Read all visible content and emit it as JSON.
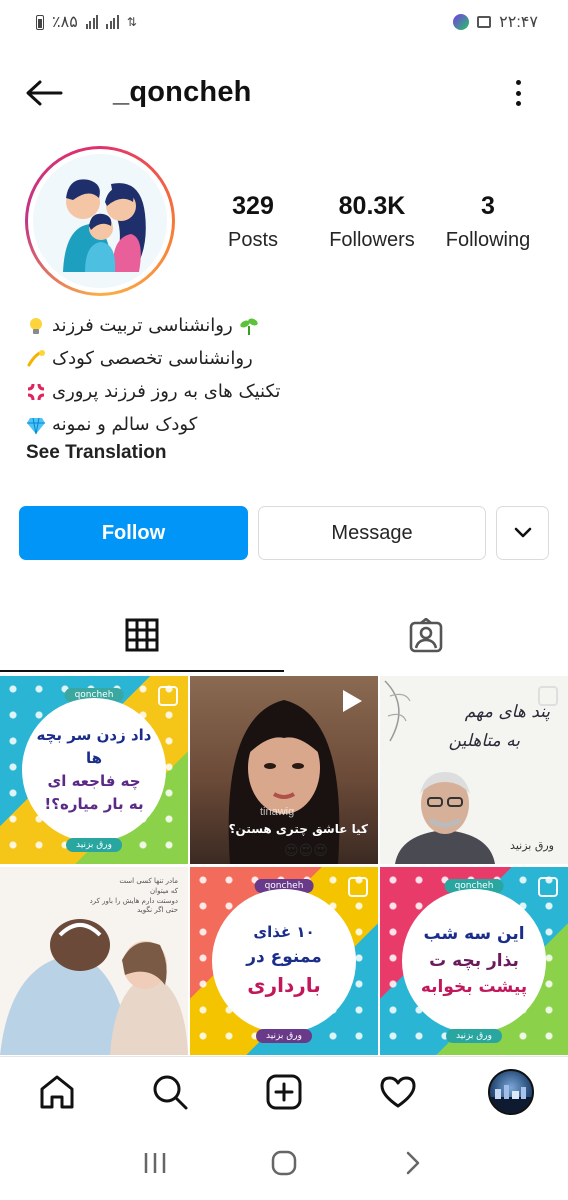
{
  "status_bar": {
    "battery_text": "٪۸۵",
    "time": "۲۲:۴۷"
  },
  "header": {
    "username": "_qoncheh"
  },
  "profile": {
    "stats": [
      {
        "value": "329",
        "label": "Posts"
      },
      {
        "value": "80.3K",
        "label": "Followers"
      },
      {
        "value": "3",
        "label": "Following"
      }
    ],
    "bio": [
      {
        "text": "روانشناسی تربیت فرزند",
        "emoji_start": "seedling-icon",
        "emoji_end": "lightbulb-icon"
      },
      {
        "text": "روانشناسی تخصصی کودک",
        "emoji_start": "",
        "emoji_end": "dizzy-icon"
      },
      {
        "text": "تکنیک های به روز فرزند پروری",
        "emoji_start": "",
        "emoji_end": "anger-icon"
      },
      {
        "text": "کودک سالم و نمونه",
        "emoji_start": "",
        "emoji_end": "gem-icon"
      }
    ],
    "see_translation": "See Translation"
  },
  "actions": {
    "follow": "Follow",
    "message": "Message"
  },
  "posts": [
    {
      "lines": [
        "داد زدن سر بچه ها",
        "چه فاجعه ای",
        "به بار میاره؟!"
      ],
      "tag": "qoncheh",
      "footer": "ورق بزنید",
      "bg": "#f4c400"
    },
    {
      "lines": [
        "کیا عاشق چتری هستن؟"
      ],
      "watermark": "tinawig",
      "reaction": "😍😍😍"
    },
    {
      "lines": [
        "پند های مهم",
        "به متاهلین"
      ],
      "footer": "ورق بزنید"
    },
    {
      "lines": [
        "مادر تنها کسی است",
        "که میتوان",
        "دوستت دارم هایش را باور کرد",
        "حتی اگر نگوید"
      ]
    },
    {
      "lines": [
        "۱۰ غذای",
        "ممنوع در",
        "بارداری"
      ],
      "tag": "qoncheh",
      "footer": "ورق بزنید",
      "bg": "#f26b5b"
    },
    {
      "lines": [
        "این سه شب",
        "بذار بچه ت",
        "پیشت بخوابه"
      ],
      "tag": "qoncheh",
      "footer": "ورق بزنید",
      "bg": "#e93b6a"
    }
  ],
  "colors": {
    "accent": "#0095f6",
    "text": "#262626",
    "border": "#dbdbdb"
  }
}
